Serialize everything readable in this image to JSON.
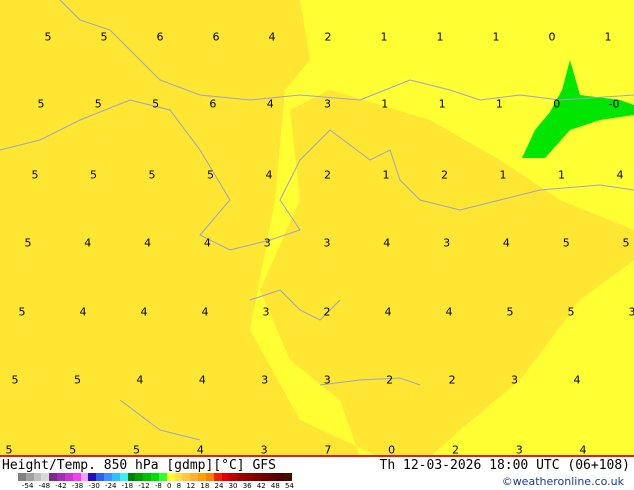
{
  "map": {
    "rows": [
      [
        "5",
        "5",
        "6",
        "6",
        "4",
        "2",
        "1",
        "1",
        "1",
        "0",
        "1"
      ],
      [
        "5",
        "5",
        "5",
        "6",
        "4",
        "3",
        "1",
        "1",
        "1",
        "0",
        "-0"
      ],
      [
        "5",
        "5",
        "5",
        "5",
        "4",
        "2",
        "1",
        "2",
        "1",
        "1",
        "4"
      ],
      [
        "5",
        "4",
        "4",
        "4",
        "3",
        "3",
        "4",
        "3",
        "4",
        "5",
        "5"
      ],
      [
        "5",
        "4",
        "4",
        "4",
        "3",
        "2",
        "4",
        "4",
        "5",
        "5",
        "3"
      ],
      [
        "5",
        "5",
        "4",
        "4",
        "3",
        "3",
        "2",
        "2",
        "3",
        "4"
      ],
      [
        "5",
        "5",
        "5",
        "4",
        "3",
        "7",
        "0",
        "2",
        "3",
        "4"
      ]
    ],
    "colors": {
      "base": "#ffe632",
      "warm": "#ffff33",
      "cold": "#00e600",
      "coast": "#9aa6c8",
      "border": "#e02020"
    }
  },
  "footer": {
    "title": "Height/Temp. 850 hPa [gdmp][°C] GFS",
    "datetime": "Th 12-03-2026 18:00 UTC (06+108)",
    "credit": "©weatheronline.co.uk",
    "legend_ticks": [
      "-54",
      "-48",
      "-42",
      "-38",
      "-30",
      "-24",
      "-18",
      "-12",
      "-8",
      "0",
      "8",
      "12",
      "18",
      "24",
      "30",
      "36",
      "42",
      "48",
      "54"
    ],
    "legend_colors": [
      "#808080",
      "#a0a0a0",
      "#c0c0c0",
      "#d8d8d8",
      "#7a2a8a",
      "#a030b0",
      "#c838d0",
      "#f040f0",
      "#f8a0f8",
      "#2010c0",
      "#3060f0",
      "#4090ff",
      "#30c0ff",
      "#40f0f0",
      "#008000",
      "#00a000",
      "#00c000",
      "#00e000",
      "#30ff30",
      "#ffff30",
      "#ffe040",
      "#ffc840",
      "#ffb030",
      "#ffa000",
      "#ff8000",
      "#f02000",
      "#e00000",
      "#c00000",
      "#a00000",
      "#900000",
      "#800000",
      "#700000",
      "#600000",
      "#500000",
      "#401000"
    ]
  }
}
